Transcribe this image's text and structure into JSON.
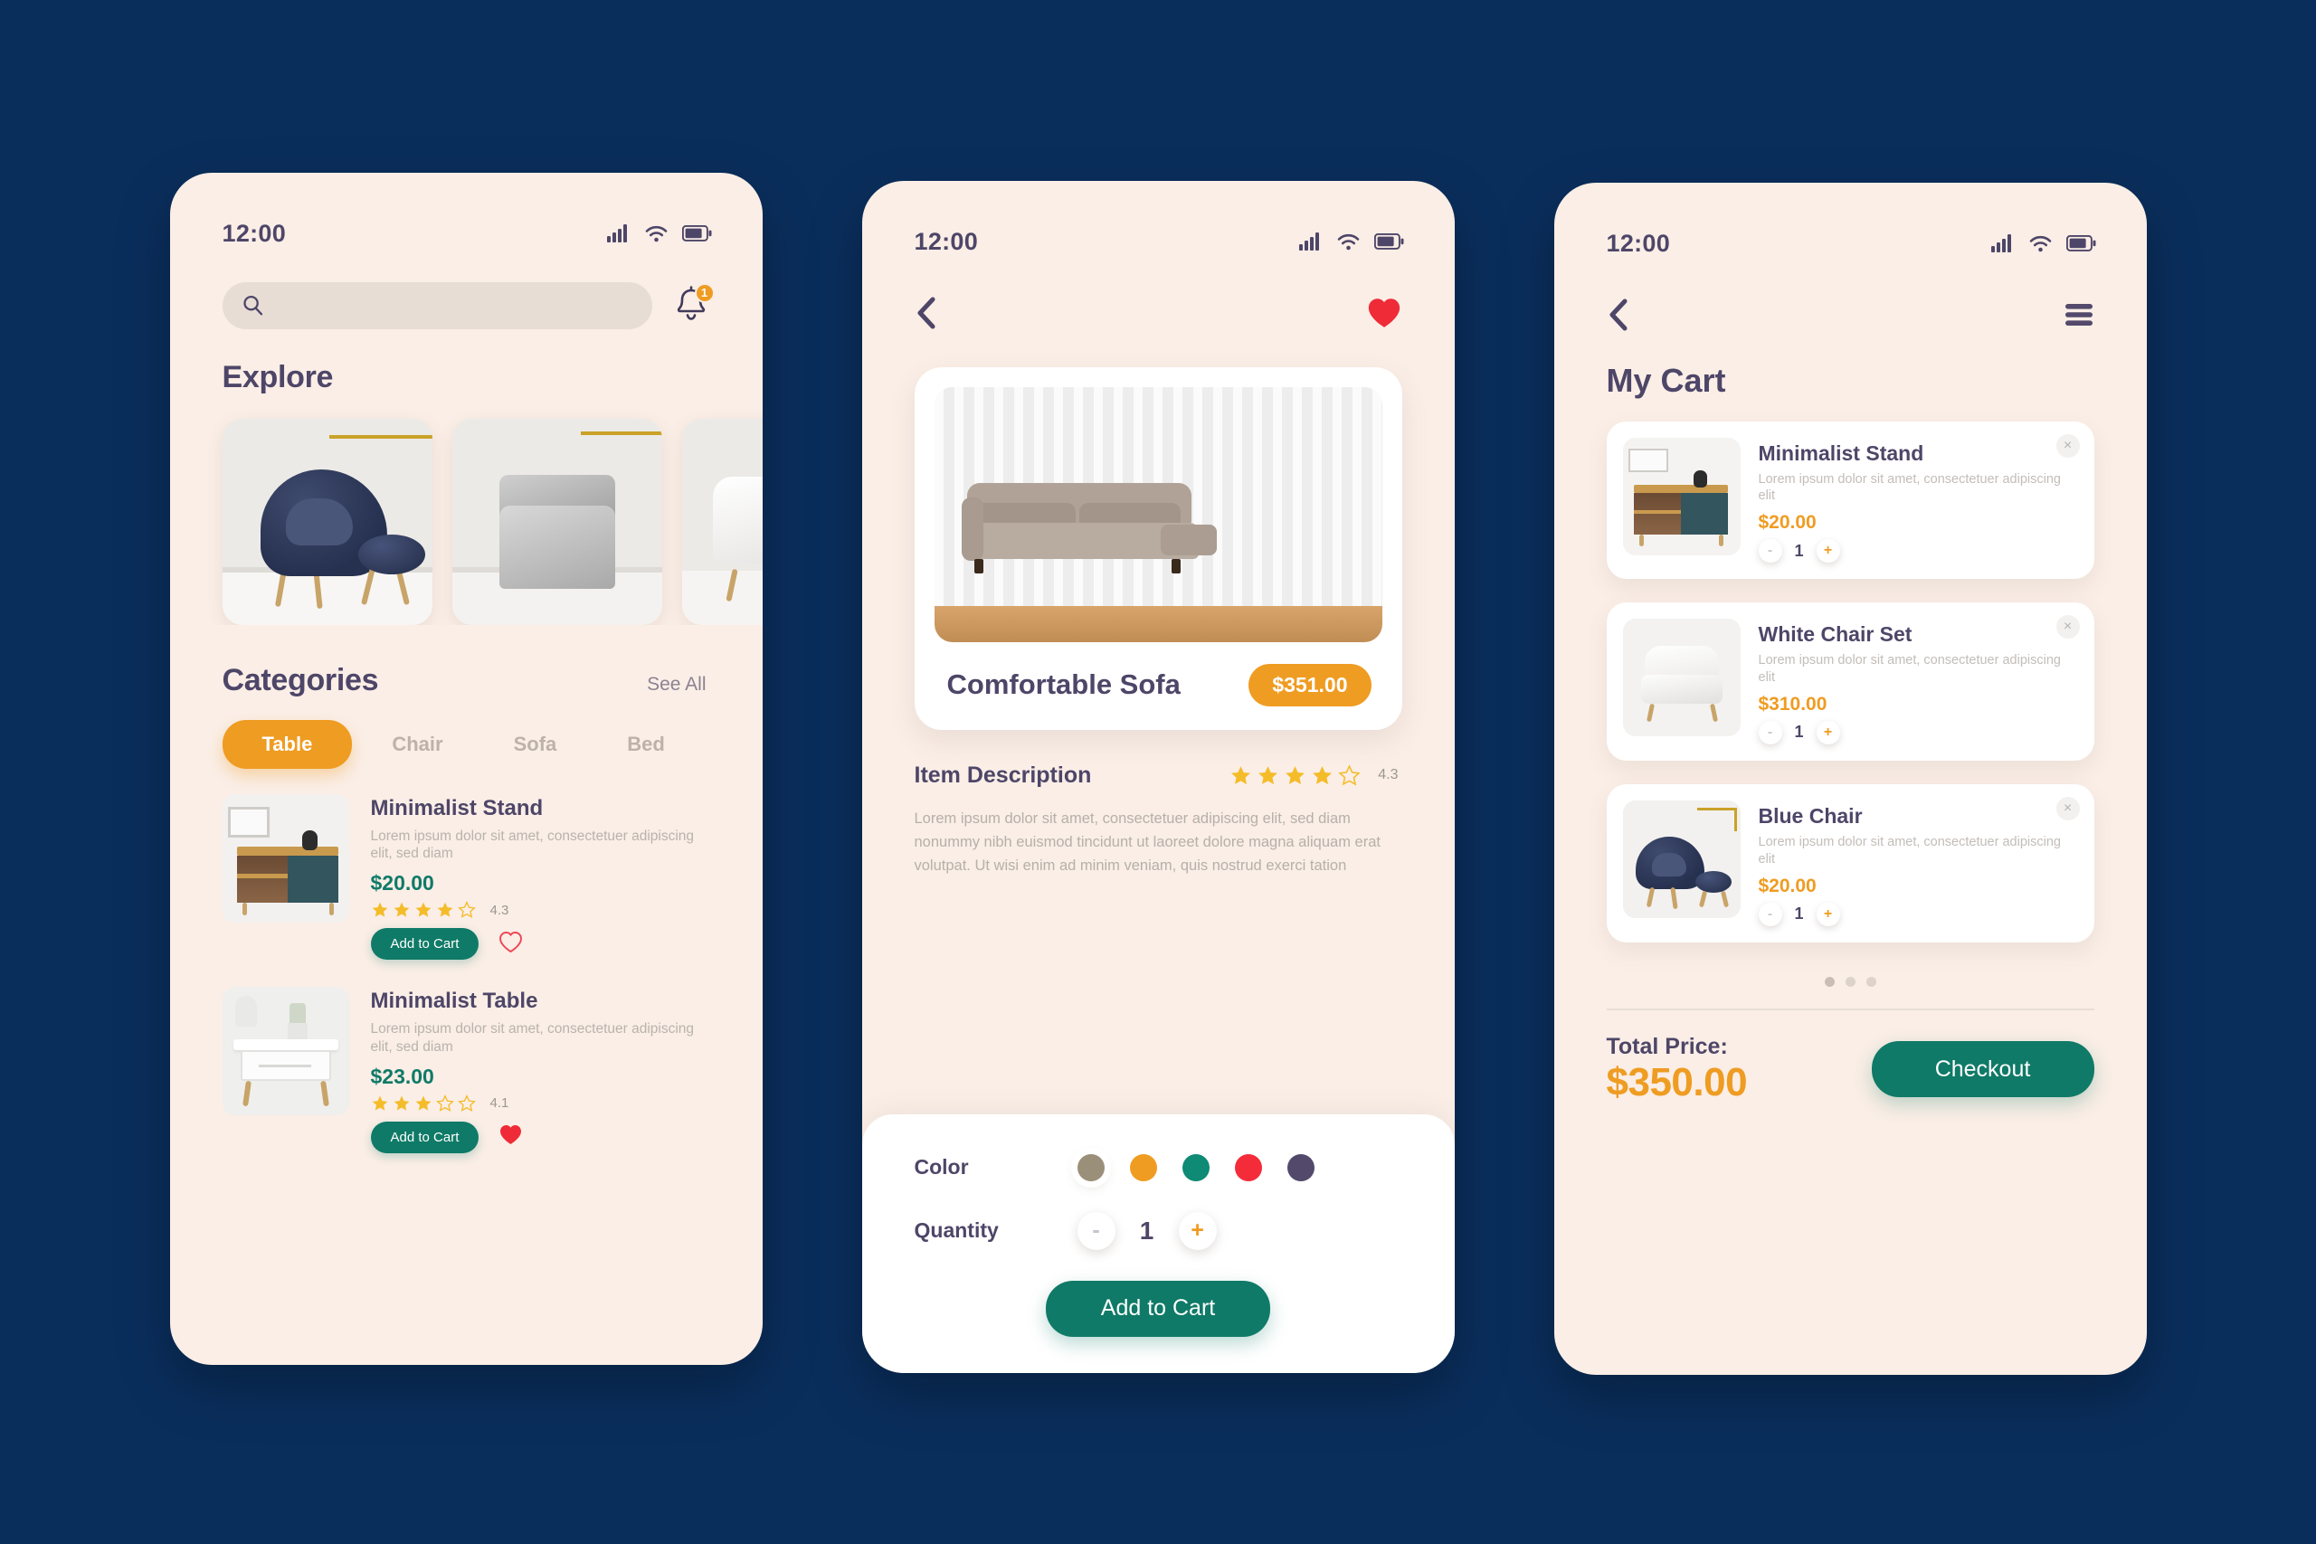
{
  "theme": {
    "background": "#0a2e5c",
    "screen_bg": "#faeee6",
    "accent_orange": "#ef9c22",
    "accent_green": "#0f7a67",
    "text_dark": "#4e4668",
    "text_muted": "#b9b3ae",
    "heart_red": "#ef2b37"
  },
  "status_bar": {
    "time": "12:00"
  },
  "screen_home": {
    "search": {
      "value": "",
      "placeholder": ""
    },
    "notification_count": "1",
    "explore_title": "Explore",
    "categories_title": "Categories",
    "see_all": "See All",
    "category_tabs": [
      {
        "label": "Table",
        "active": true
      },
      {
        "label": "Chair",
        "active": false
      },
      {
        "label": "Sofa",
        "active": false
      },
      {
        "label": "Bed",
        "active": false
      }
    ],
    "products": [
      {
        "name": "Minimalist Stand",
        "desc": "Lorem ipsum dolor sit amet, consectetuer adipiscing elit, sed diam",
        "price": "$20.00",
        "rating": "4.3",
        "stars_filled": 4,
        "add_label": "Add to Cart",
        "favorited": false
      },
      {
        "name": "Minimalist Table",
        "desc": "Lorem ipsum dolor sit amet, consectetuer adipiscing elit, sed diam",
        "price": "$23.00",
        "rating": "4.1",
        "stars_filled": 3,
        "add_label": "Add to Cart",
        "favorited": true
      }
    ]
  },
  "screen_detail": {
    "product_name": "Comfortable Sofa",
    "price": "$351.00",
    "favorited": true,
    "description_title": "Item Description",
    "rating": "4.3",
    "stars_filled": 4,
    "description_text": "Lorem ipsum dolor sit amet, consectetuer adipiscing elit, sed diam nonummy nibh euismod tincidunt ut laoreet dolore magna aliquam erat volutpat. Ut wisi enim ad minim veniam, quis nostrud exerci tation",
    "color_label": "Color",
    "colors": [
      {
        "hex": "#9a9079",
        "selected": true
      },
      {
        "hex": "#ef9c22",
        "selected": false
      },
      {
        "hex": "#0f8a74",
        "selected": false
      },
      {
        "hex": "#f42c3a",
        "selected": false
      },
      {
        "hex": "#534a6b",
        "selected": false
      }
    ],
    "quantity_label": "Quantity",
    "quantity": "1",
    "minus_label": "-",
    "plus_label": "+",
    "add_to_cart_label": "Add to Cart"
  },
  "screen_cart": {
    "title": "My Cart",
    "items": [
      {
        "name": "Minimalist Stand",
        "desc": "Lorem ipsum dolor sit amet, consectetuer adipiscing elit",
        "price": "$20.00",
        "qty": "1",
        "thumb": "stand"
      },
      {
        "name": "White Chair Set",
        "desc": "Lorem ipsum dolor sit amet, consectetuer adipiscing elit",
        "price": "$310.00",
        "qty": "1",
        "thumb": "white-chair"
      },
      {
        "name": "Blue Chair",
        "desc": "Lorem ipsum dolor sit amet, consectetuer adipiscing elit",
        "price": "$20.00",
        "qty": "1",
        "thumb": "blue-chair"
      }
    ],
    "minus_label": "-",
    "plus_label": "+",
    "close_label": "×",
    "pagination_dots": 3,
    "total_label": "Total Price:",
    "total_value": "$350.00",
    "checkout_label": "Checkout"
  }
}
